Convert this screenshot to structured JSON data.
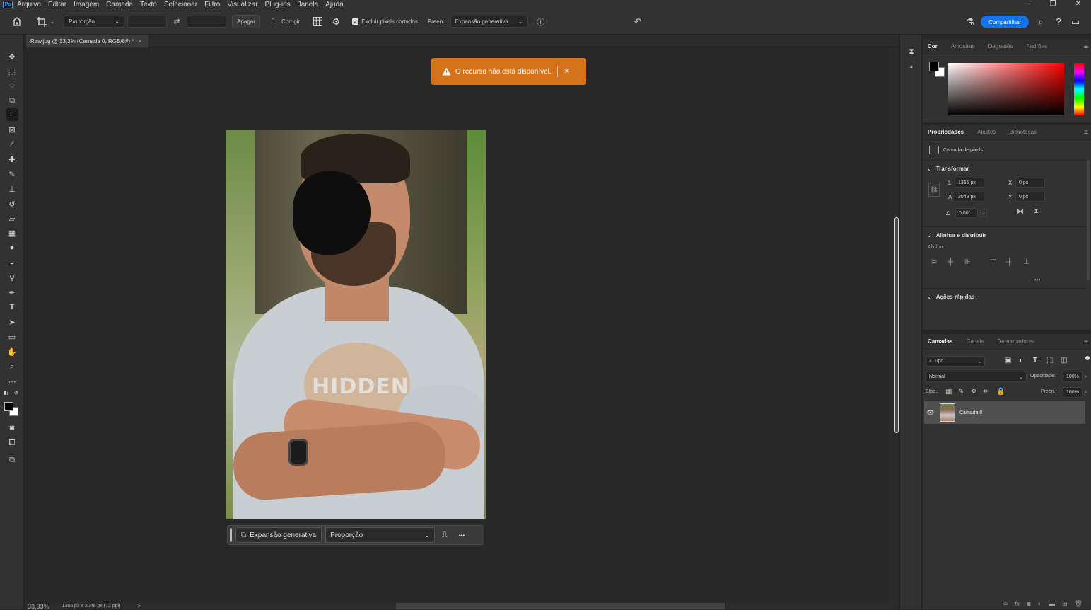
{
  "menubar": {
    "logo": "Ps",
    "items": [
      "Arquivo",
      "Editar",
      "Imagem",
      "Camada",
      "Texto",
      "Selecionar",
      "Filtro",
      "Visualizar",
      "Plug-ins",
      "Janela",
      "Ajuda"
    ]
  },
  "options": {
    "ratio_select": "Proporção",
    "clear_button": "Apagar",
    "straighten_label": "Corrigir",
    "delete_cropped_label": "Excluir pixels cortados",
    "fill_label": "Preen.:",
    "fill_select": "Expansão generativa",
    "share_button": "Compartilhar"
  },
  "document": {
    "tab_title": "Raw.jpg @ 33,3% (Camada 0, RGB/8#) *",
    "tab_close": "×",
    "image_print_text": "HIDDEN"
  },
  "notification": {
    "message": "O recurso não está disponível.",
    "close": "×"
  },
  "context_bar": {
    "generative_button": "Expansão generativa",
    "ratio_select": "Proporção",
    "more": "•••"
  },
  "status": {
    "zoom": "33,33%",
    "doc_info": "1365 px x 2048 px (72 ppi)",
    "arrow": ">"
  },
  "color_panel": {
    "tabs": [
      "Cor",
      "Amostras",
      "Degradês",
      "Padrões"
    ],
    "active_tab": "Cor",
    "foreground": "#000000",
    "background": "#ffffff"
  },
  "properties_panel": {
    "tabs": [
      "Propriedades",
      "Ajustes",
      "Bibliotecas"
    ],
    "layer_type": "Camada de pixels",
    "transform_title": "Transformar",
    "width_label": "L",
    "width_value": "1365 px",
    "height_label": "A",
    "height_value": "2048 px",
    "x_label": "X",
    "x_value": "0 px",
    "y_label": "Y",
    "y_value": "0 px",
    "angle_value": "0,00°",
    "align_title": "Alinhar e distribuir",
    "align_label": "Alinhar:",
    "more": "•••",
    "quick_actions_title": "Ações rápidas"
  },
  "layers_panel": {
    "tabs": [
      "Camadas",
      "Canais",
      "Demarcadores"
    ],
    "filter_kind": "Tipo",
    "blend_mode": "Normal",
    "opacity_label": "Opacidade:",
    "opacity_value": "100%",
    "lock_label": "Bloq.:",
    "fill_label": "Preen.:",
    "fill_value": "100%",
    "layers": [
      {
        "name": "Camada 0",
        "visible": true
      }
    ]
  },
  "colors": {
    "accent_orange": "#d4731c",
    "share_blue": "#1473e6"
  }
}
